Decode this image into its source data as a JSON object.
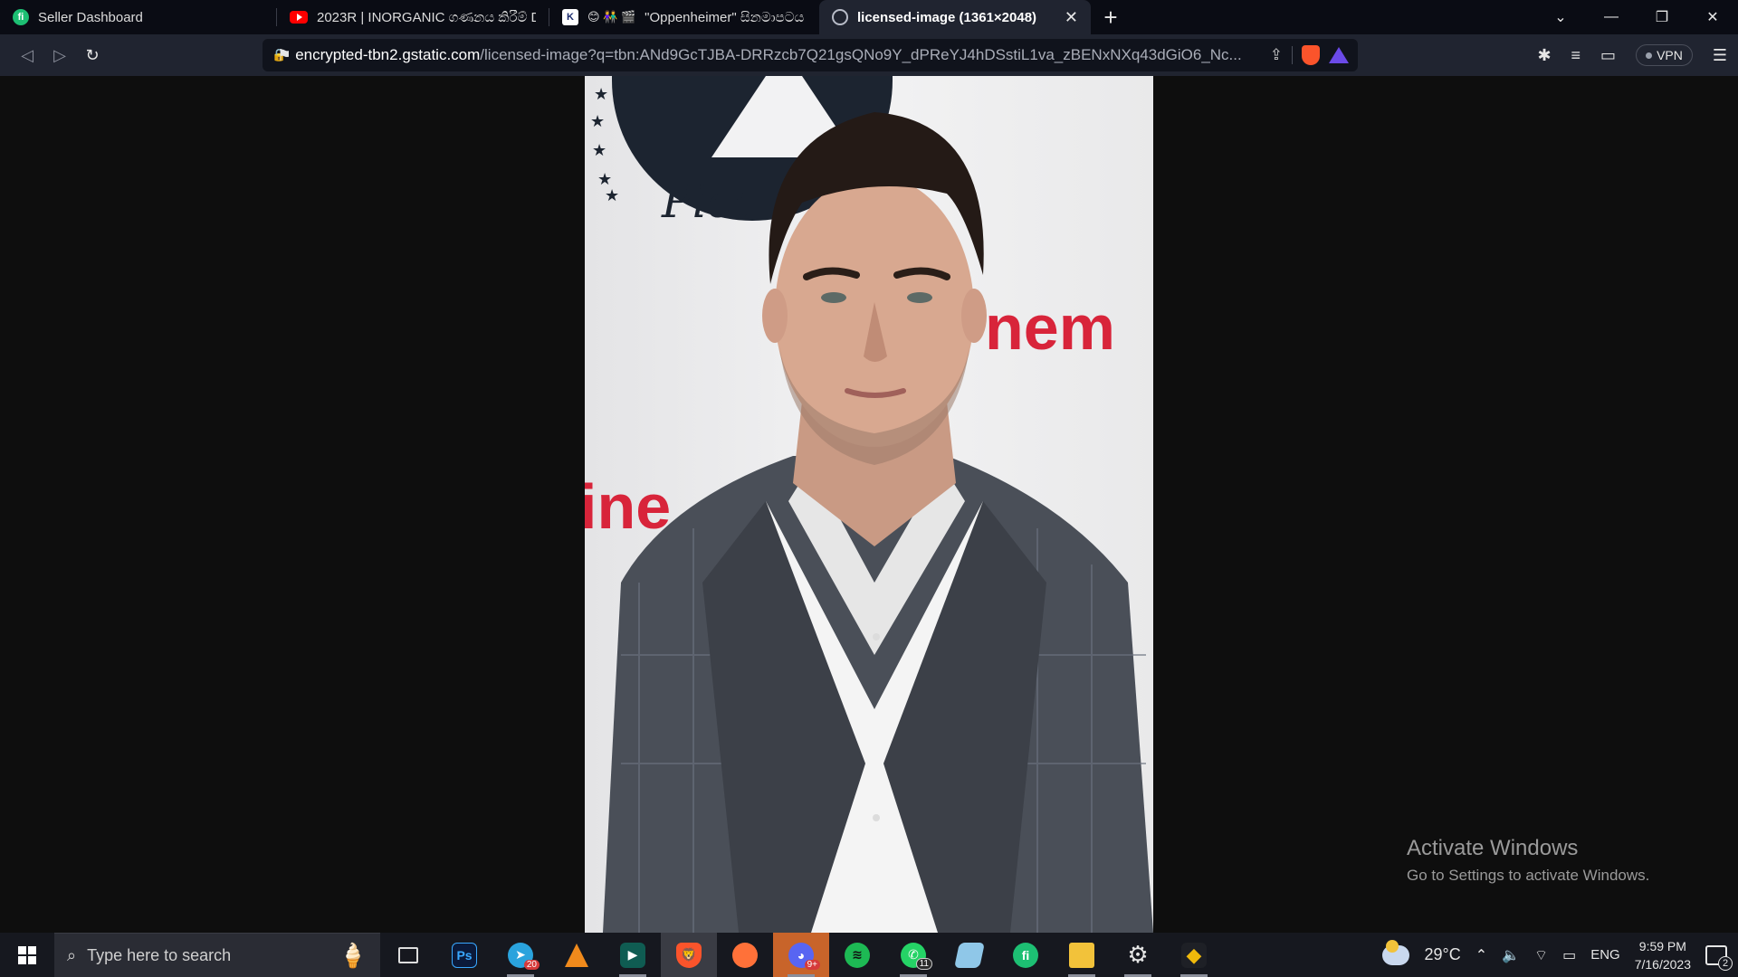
{
  "browser": {
    "tabs": [
      {
        "label": "Seller Dashboard",
        "favicon": "fiverr-icon"
      },
      {
        "label": "2023R | INORGANIC ගණනය කිරීම් D",
        "favicon": "youtube-icon"
      },
      {
        "label": "\"Oppenheimer\" සිනමාපටය",
        "favicon": "k-site-icon",
        "prefix_emojis": "😊 👫 🎬"
      },
      {
        "label": "licensed-image (1361×2048)",
        "favicon": "globe-icon",
        "active": true
      }
    ],
    "new_tab_symbol": "+",
    "address": {
      "host": "encrypted-tbn2.gstatic.com",
      "path": "/licensed-image?q=tbn:ANd9GcTJBA-DRRzcb7Q21gsQNo9Y_dPReYJ4hDSstiL1va_zBENxNXq43dGiO6_Nc..."
    },
    "vpn_label": "VPN"
  },
  "image": {
    "logo_text": "Pict",
    "backdrop_text_right": "nem",
    "backdrop_text_left": "ine"
  },
  "watermark": {
    "title": "Activate Windows",
    "subtitle": "Go to Settings to activate Windows."
  },
  "taskbar": {
    "search_placeholder": "Type here to search",
    "apps": [
      {
        "name": "task-view",
        "badge": ""
      },
      {
        "name": "photoshop",
        "label": "Ps",
        "badge": ""
      },
      {
        "name": "telegram",
        "badge": "20"
      },
      {
        "name": "vlc",
        "badge": ""
      },
      {
        "name": "filmora",
        "badge": ""
      },
      {
        "name": "brave",
        "badge": ""
      },
      {
        "name": "firefox",
        "badge": ""
      },
      {
        "name": "discord",
        "badge": "9+"
      },
      {
        "name": "spotify",
        "badge": ""
      },
      {
        "name": "whatsapp",
        "badge": "11"
      },
      {
        "name": "notepad",
        "badge": ""
      },
      {
        "name": "fiverr",
        "label": "fi",
        "badge": ""
      },
      {
        "name": "file-explorer",
        "badge": ""
      },
      {
        "name": "settings",
        "badge": ""
      },
      {
        "name": "binance",
        "badge": ""
      }
    ],
    "weather": "29°C",
    "language": "ENG",
    "time": "9:59 PM",
    "date": "7/16/2023",
    "notifications": "2"
  }
}
